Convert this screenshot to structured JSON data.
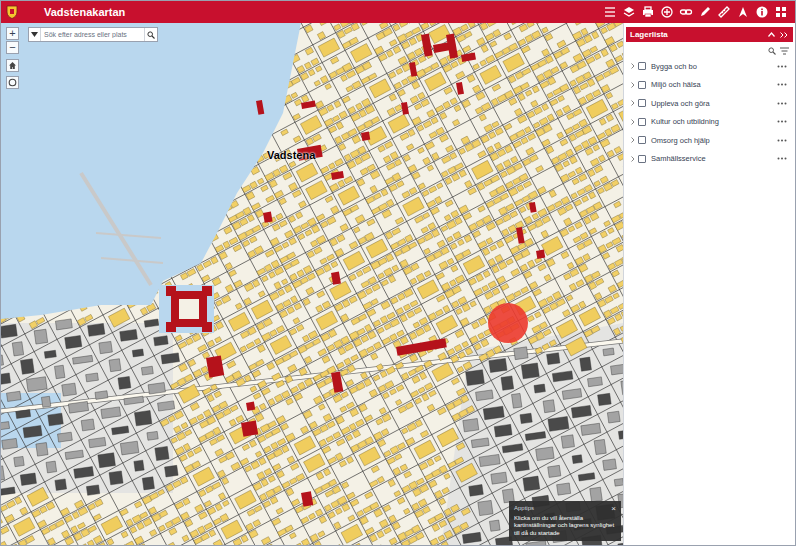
{
  "header": {
    "title": "Vadstenakartan"
  },
  "map_controls": {
    "zoom_in": "+",
    "zoom_out": "−"
  },
  "search": {
    "placeholder": "Sök efter adress eller plats"
  },
  "map": {
    "place_labels": [
      "Vadstena"
    ]
  },
  "layer_panel": {
    "title": "Lagerlista",
    "layers": [
      {
        "label": "Bygga och bo",
        "checked": false,
        "expanded": false
      },
      {
        "label": "Miljö och hälsa",
        "checked": false,
        "expanded": false
      },
      {
        "label": "Uppleva och göra",
        "checked": false,
        "expanded": false
      },
      {
        "label": "Kultur och utbildning",
        "checked": false,
        "expanded": false
      },
      {
        "label": "Omsorg och hjälp",
        "checked": false,
        "expanded": false
      },
      {
        "label": "Samhällsservice",
        "checked": false,
        "expanded": false
      }
    ]
  },
  "tooltip": {
    "title": "Apptips",
    "text": "Klicka om du vill återställa kartinställningar och lagrens synlighet till då du startade",
    "close": "×"
  }
}
